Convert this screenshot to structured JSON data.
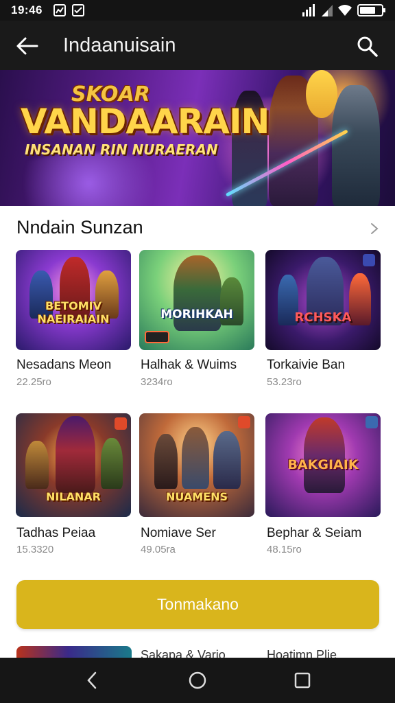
{
  "status_bar": {
    "time": "19:46"
  },
  "app_bar": {
    "title": "Indaanuisain"
  },
  "hero": {
    "kicker": "SKOAR",
    "headline": "VANDAARAIN",
    "tagline": "INSANAN RIN NURAERAN"
  },
  "section": {
    "title": "Nndain Sunzan"
  },
  "games": [
    {
      "name": "Nesadans Meon",
      "size": "22.25ro",
      "logo": "BETOMIV NAEIRAIAIN"
    },
    {
      "name": "Halhak & Wuims",
      "size": "3234ro",
      "logo": "MORIHKAH"
    },
    {
      "name": "Torkaivie Ban",
      "size": "53.23ro",
      "logo": "RCHSKA"
    },
    {
      "name": "Tadhas Peiaa",
      "size": "15.3320",
      "logo": "NILANAR"
    },
    {
      "name": "Nomiave Ser",
      "size": "49.05ra",
      "logo": "NUAMENS"
    },
    {
      "name": "Bephar & Seiam",
      "size": "48.15ro",
      "logo": "BAKGIAIK"
    }
  ],
  "install_button": {
    "label": "Tonmakano"
  },
  "peek_row": [
    {
      "name": "Sakapa & Vario"
    },
    {
      "name": "Hoatimn Plie"
    }
  ],
  "icons": {
    "back": "arrow-left-icon",
    "search": "magnifier-icon",
    "chevron": "chevron-right-icon",
    "nav_back": "triangle-back-icon",
    "nav_home": "circle-home-icon",
    "nav_recents": "square-recents-icon"
  },
  "colors": {
    "app_bar_bg": "#1a1a1a",
    "accent": "#d9b51c",
    "nav_bar_bg": "#161616"
  }
}
